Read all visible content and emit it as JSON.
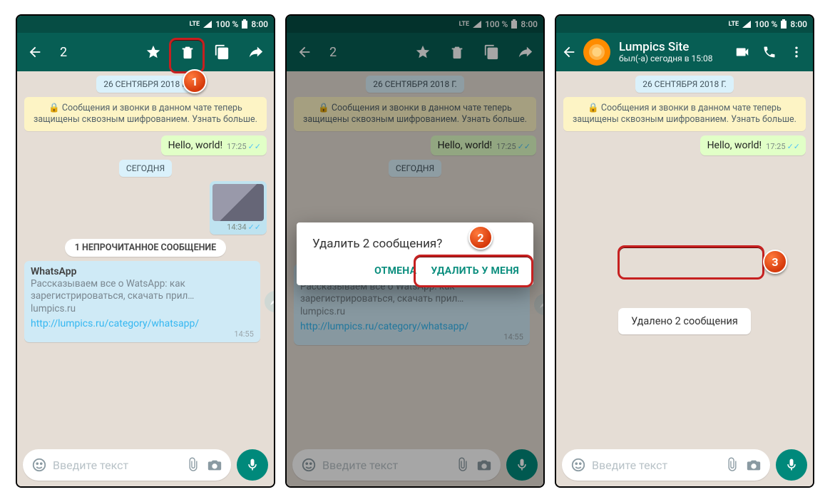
{
  "status": {
    "lte": "LTE",
    "signal": "▲",
    "battery": "100 %",
    "time": "8:00"
  },
  "selection": {
    "count": "2"
  },
  "chat_header": {
    "name": "Lumpics Site",
    "status": "был(-а) сегодня в 15:08"
  },
  "chips": {
    "date": "26 СЕНТЯБРЯ 2018 Г.",
    "today": "СЕГОДНЯ"
  },
  "encryption": "🔒 Сообщения и звонки в данном чате теперь защищены сквозным шифрованием. Узнать больше.",
  "unread": "1 НЕПРОЧИТАННОЕ СООБЩЕНИЕ",
  "msg_hello": {
    "text": "Hello, world!",
    "time": "17:25"
  },
  "msg_img": {
    "time": "14:34"
  },
  "msg_in": {
    "title": "WhatsApp",
    "body": "Рассказываем все о WatsApp: как зарегистрироваться, скачать прил…",
    "domain": "lumpics.ru",
    "link": "http://lumpics.ru/category/whatsapp/",
    "time": "14:55"
  },
  "input": {
    "placeholder": "Введите текст"
  },
  "dialog": {
    "title": "Удалить 2 сообщения?",
    "cancel": "ОТМЕНА",
    "confirm": "УДАЛИТЬ У МЕНЯ"
  },
  "toast": "Удалено 2 сообщения",
  "badges": {
    "b1": "1",
    "b2": "2",
    "b3": "3"
  }
}
